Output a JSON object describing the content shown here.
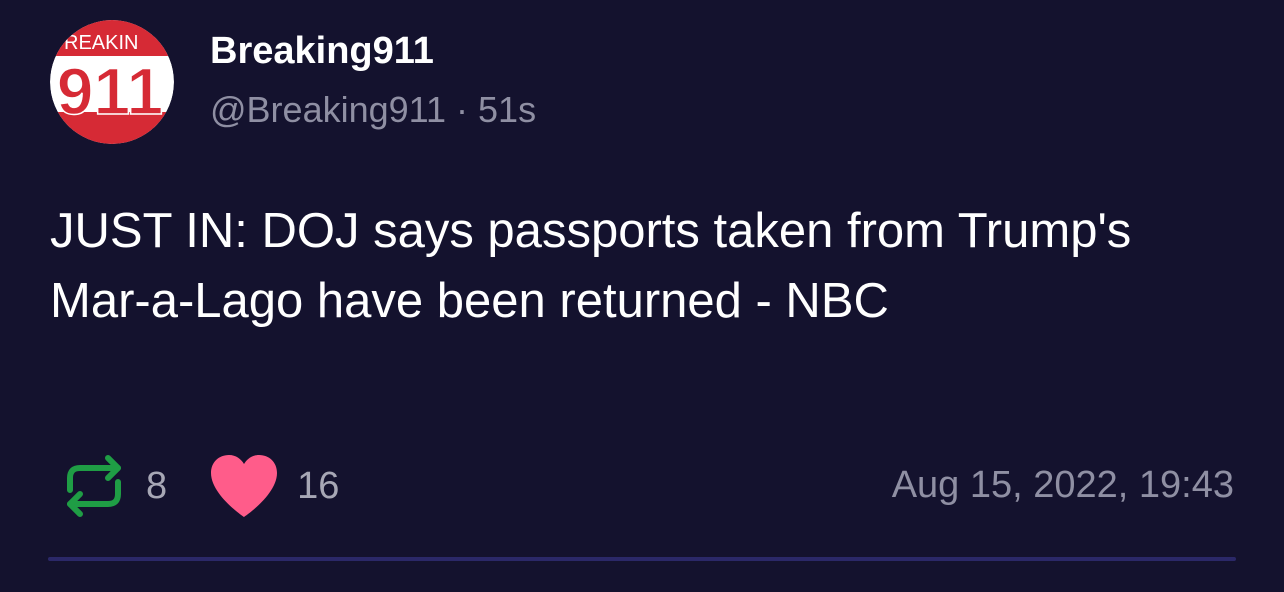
{
  "post": {
    "avatar": {
      "logo_top_text": "REAKIN",
      "logo_number": "911",
      "icon": "breaking911-logo-avatar"
    },
    "author_name": "Breaking911",
    "handle": "@Breaking911",
    "separator": "·",
    "age": "51s",
    "text": "JUST IN: DOJ says passports taken from Trump's Mar-a-Lago have been returned - NBC",
    "retweet": {
      "icon": "retweet-icon",
      "count": "8",
      "color": "#1f9d45"
    },
    "like": {
      "icon": "heart-icon",
      "count": "16",
      "color": "#ff5c8a"
    },
    "timestamp": "Aug 15, 2022, 19:43"
  },
  "colors": {
    "background": "#14122e",
    "divider": "#2b2868",
    "avatar_red": "#d62a35"
  }
}
